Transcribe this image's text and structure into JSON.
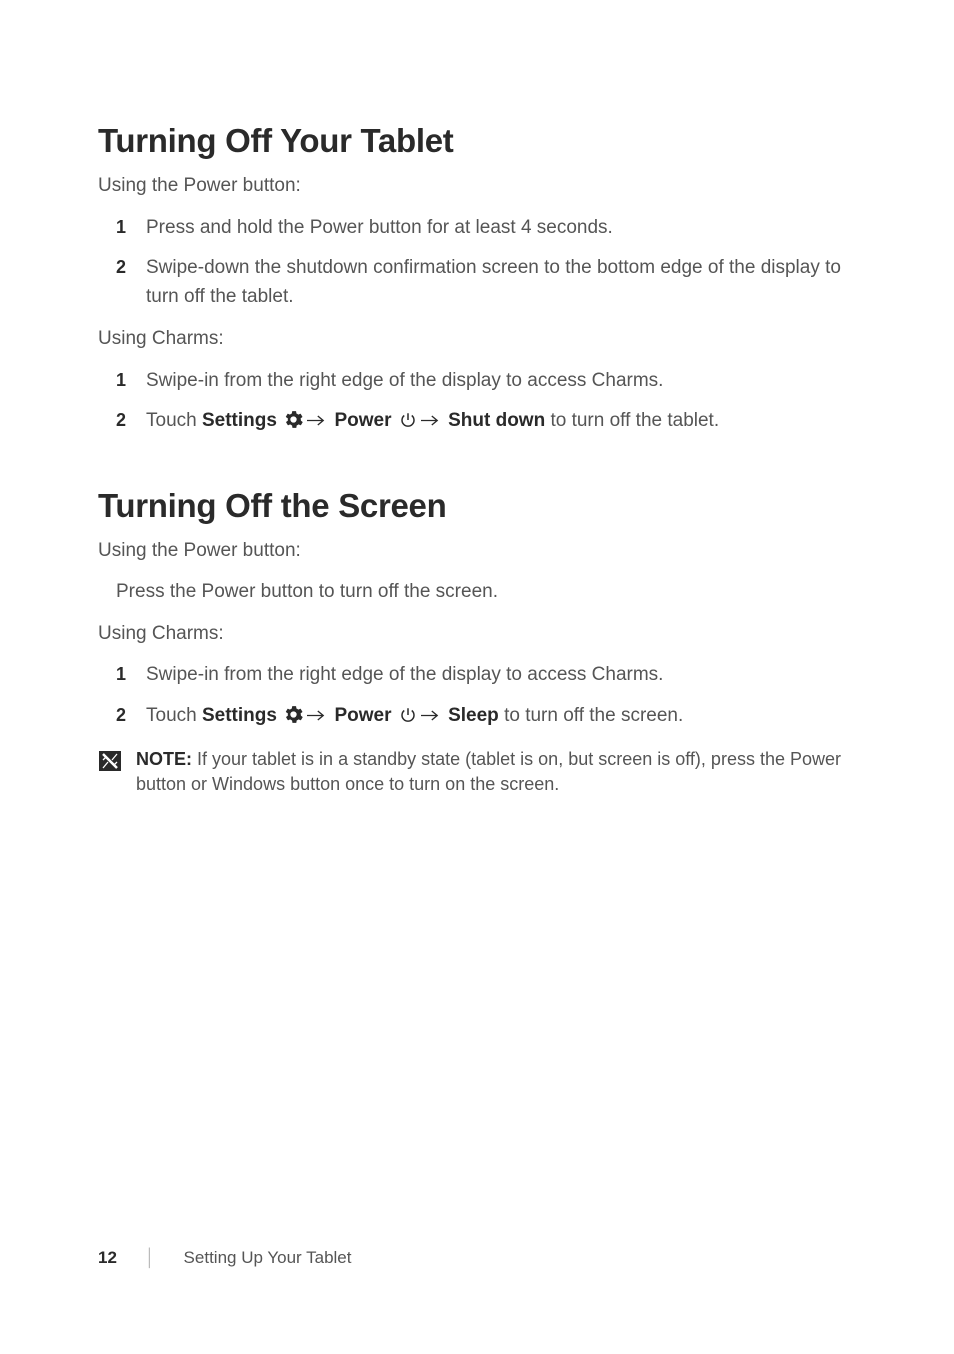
{
  "section1": {
    "heading": "Turning Off Your Tablet",
    "intro1": "Using the Power button:",
    "list1": {
      "item1": "Press and hold the Power button for at least 4 seconds.",
      "item2": "Swipe-down the shutdown confirmation screen to the bottom edge of the display to turn off the tablet."
    },
    "intro2": "Using Charms:",
    "list2": {
      "item1": "Swipe-in from the right edge of the display to access Charms.",
      "item2": {
        "t1": "Touch ",
        "b1": "Settings",
        "b2": "Power",
        "b3": "Shut down",
        "t2": " to turn off the tablet."
      }
    }
  },
  "section2": {
    "heading": "Turning Off the Screen",
    "intro1": "Using the Power button:",
    "plain": "Press the Power button to turn off the screen.",
    "intro2": "Using Charms:",
    "list": {
      "item1": "Swipe-in from the right edge of the display to access Charms.",
      "item2": {
        "t1": "Touch ",
        "b1": "Settings",
        "b2": "Power",
        "b3": "Sleep",
        "t2": " to turn off the screen."
      }
    },
    "note": {
      "label": "NOTE:",
      "text": " If your tablet is in a standby state (tablet is on, but screen is off), press the Power button or Windows button once to turn on the screen."
    }
  },
  "footer": {
    "page": "12",
    "chapter": "Setting Up Your Tablet"
  }
}
